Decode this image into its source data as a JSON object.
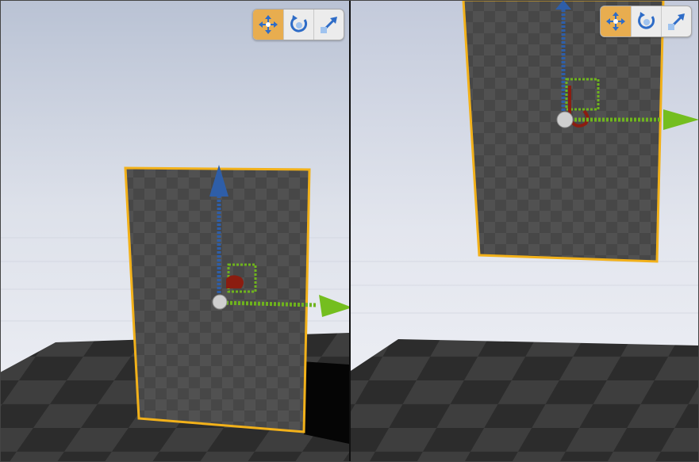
{
  "viewports": [
    {
      "id": "left",
      "toolbar": {
        "active_tool": "translate",
        "tools": [
          "translate",
          "rotate",
          "scale"
        ]
      }
    },
    {
      "id": "right",
      "toolbar": {
        "active_tool": "translate",
        "tools": [
          "translate",
          "rotate",
          "scale"
        ]
      }
    }
  ],
  "colors": {
    "selection_outline": "#f2b11a",
    "z_axis": "#2e5ea8",
    "y_axis": "#6fb41d",
    "x_axis": "#8b1d10",
    "active_tool": "#e8ad4f",
    "sky_top": "#c9d0de",
    "sky_bottom": "#eef0f6",
    "floor_dark": "#2f2f2f",
    "floor_light": "#464646",
    "plane": "#4b4b4b"
  },
  "icons": [
    "move-icon",
    "rotate-icon",
    "scale-icon"
  ]
}
